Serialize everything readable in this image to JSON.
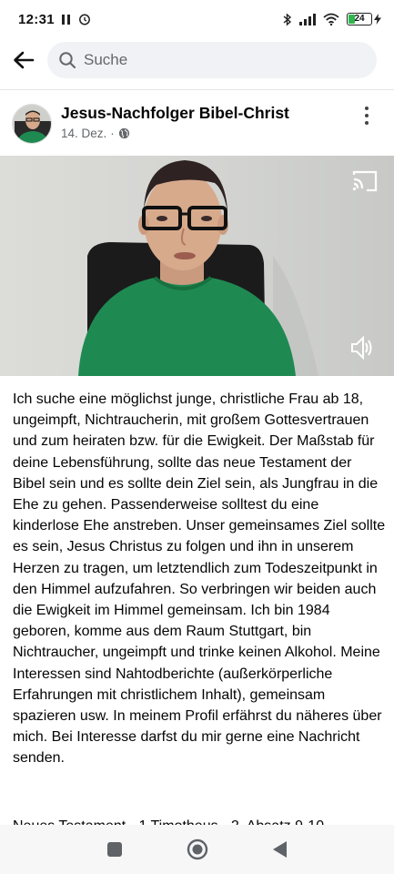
{
  "status_bar": {
    "time": "12:31",
    "battery_level": "24",
    "icons": [
      "pause-icon",
      "alarm-icon",
      "bluetooth-icon",
      "signal-icon",
      "wifi-icon",
      "battery-icon",
      "charging-icon"
    ]
  },
  "search": {
    "placeholder": "Suche"
  },
  "post": {
    "author": "Jesus-Nachfolger Bibel-Christ",
    "date": "14. Dez.",
    "separator": "·",
    "audience_icon": "globe-icon",
    "body": "Ich suche eine möglichst junge, christliche Frau ab 18, ungeimpft, Nichtraucherin, mit großem Gottesvertrauen und zum heiraten bzw. für die Ewigkeit. Der Maßstab für deine Lebensführung, sollte das neue Testament der Bibel sein und es sollte dein Ziel sein, als Jungfrau in die Ehe zu gehen. Passenderweise solltest du eine kinderlose Ehe anstreben. Unser gemeinsames Ziel sollte es sein, Jesus Christus zu folgen und ihn in unserem Herzen zu tragen, um letztendlich zum Todeszeitpunkt in den Himmel aufzufahren. So verbringen wir beiden auch die Ewigkeit im Himmel gemeinsam. Ich bin 1984 geboren, komme aus dem Raum Stuttgart, bin Nichtraucher, ungeimpft und trinke keinen Alkohol. Meine Interessen sind Nahtodberichte (außerkörperliche Erfahrungen mit christlichem Inhalt), gemeinsam spazieren usw. In meinem Profil erfährst du näheres über mich. Bei Interesse darfst du mir gerne eine Nachricht senden.",
    "body_continued": "Neues Testament - 1 Timotheus - 2. Absatz 9-10"
  },
  "navigation": {
    "buttons": [
      "recents-button",
      "home-button",
      "back-button"
    ]
  },
  "colors": {
    "search_bg": "#f0f2f5",
    "meta_text": "#65676b",
    "battery_fill": "#2db84d",
    "shirt": "#1e8a52"
  }
}
